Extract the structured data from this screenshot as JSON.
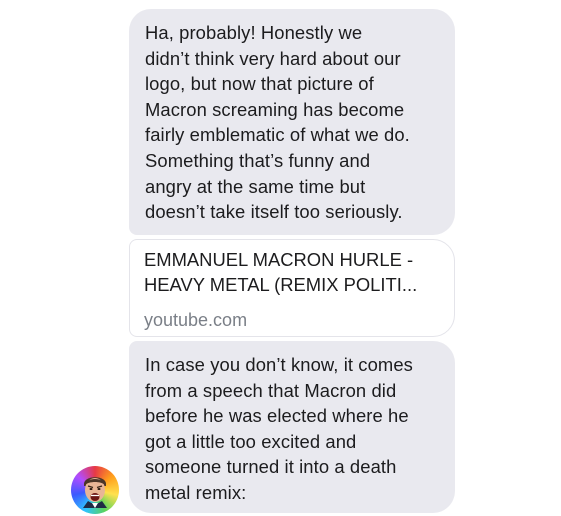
{
  "messages": [
    {
      "lines": [
        "Ha, probably! Honestly we",
        "didn’t think very hard about our",
        "logo, but now that picture of",
        "Macron screaming has become",
        "fairly emblematic of what we do.",
        "Something that’s funny and",
        "angry at the same time but",
        "doesn’t take itself too seriously."
      ]
    },
    {
      "link": {
        "title_lines": [
          "EMMANUEL MACRON HURLE -",
          "HEAVY METAL (REMIX POLITI..."
        ],
        "domain": "youtube.com"
      }
    },
    {
      "lines": [
        "In case you don’t know, it comes",
        "from a speech that Macron did",
        "before he was elected where he",
        "got a little too excited and",
        "someone turned it into a death",
        "metal remix:"
      ]
    }
  ],
  "avatar": {
    "icon": "screaming-face-avatar-icon"
  },
  "colors": {
    "bubble_background": "#e9e9ef",
    "text": "#1c1c1e",
    "link_domain": "#7a7f87",
    "card_border": "#e4e4ea"
  }
}
